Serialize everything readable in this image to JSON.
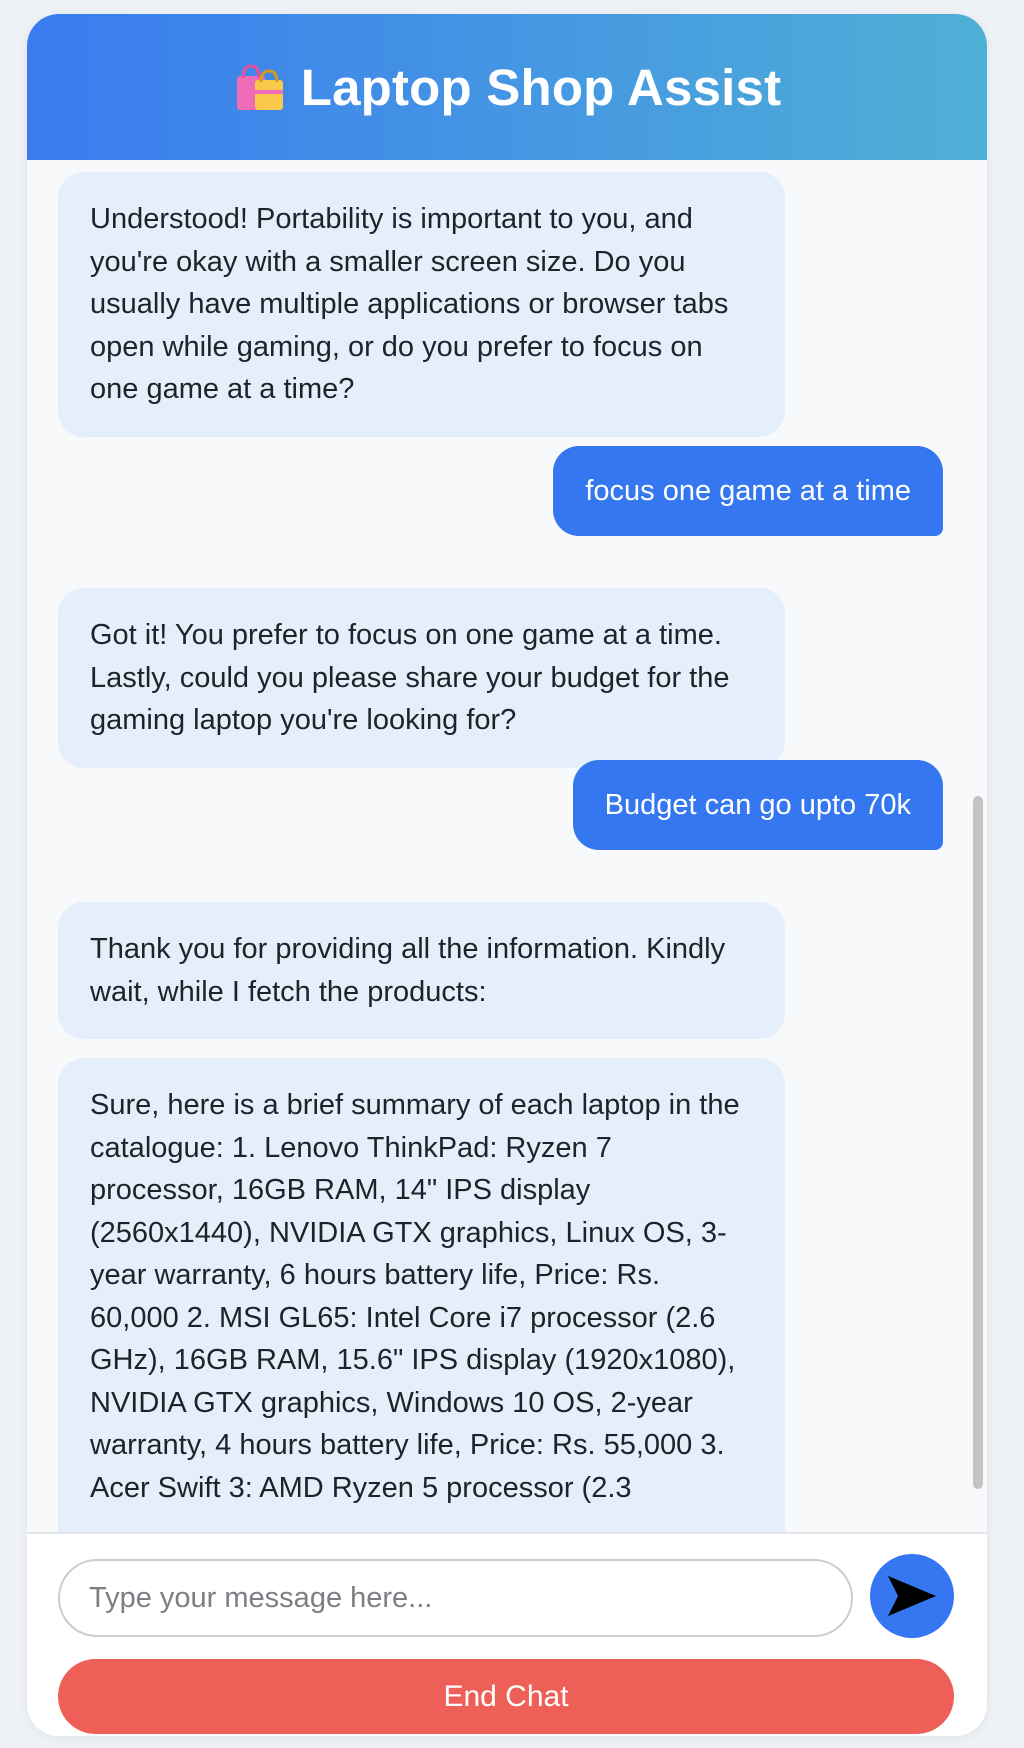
{
  "header": {
    "icon": "shopping-bags-icon",
    "title": "Laptop Shop Assist"
  },
  "messages": [
    {
      "role": "assistant",
      "text": "Understood! Portability is important to you, and you're okay with a smaller screen size. Do you usually have multiple applications or browser tabs open while gaming, or do you prefer to focus on one game at a time?"
    },
    {
      "role": "user",
      "text": "focus one game at a time"
    },
    {
      "role": "assistant",
      "text": "Got it! You prefer to focus on one game at a time. Lastly, could you please share your budget for the gaming laptop you're looking for?"
    },
    {
      "role": "user",
      "text": "Budget can go upto 70k"
    },
    {
      "role": "assistant",
      "text": "Thank you for providing all the information. Kindly wait, while I fetch the products:"
    },
    {
      "role": "assistant",
      "text": "Sure, here is a brief summary of each laptop in the catalogue: 1. Lenovo ThinkPad: Ryzen 7 processor, 16GB RAM, 14\" IPS display (2560x1440), NVIDIA GTX graphics, Linux OS, 3-year warranty, 6 hours battery life, Price: Rs. 60,000 2. MSI GL65: Intel Core i7 processor (2.6 GHz), 16GB RAM, 15.6\" IPS display (1920x1080), NVIDIA GTX graphics, Windows 10 OS, 2-year warranty, 4 hours battery life, Price: Rs. 55,000 3. Acer Swift 3: AMD Ryzen 5 processor (2.3"
    }
  ],
  "composer": {
    "placeholder": "Type your message here...",
    "send_icon": "send-arrow-icon",
    "end_label": "End Chat"
  },
  "colors": {
    "header_gradient_start": "#3a7bf0",
    "header_gradient_end": "#4fb0d6",
    "user_bubble": "#3577f0",
    "assistant_bubble": "#e4effb",
    "end_button": "#ee5f57"
  }
}
